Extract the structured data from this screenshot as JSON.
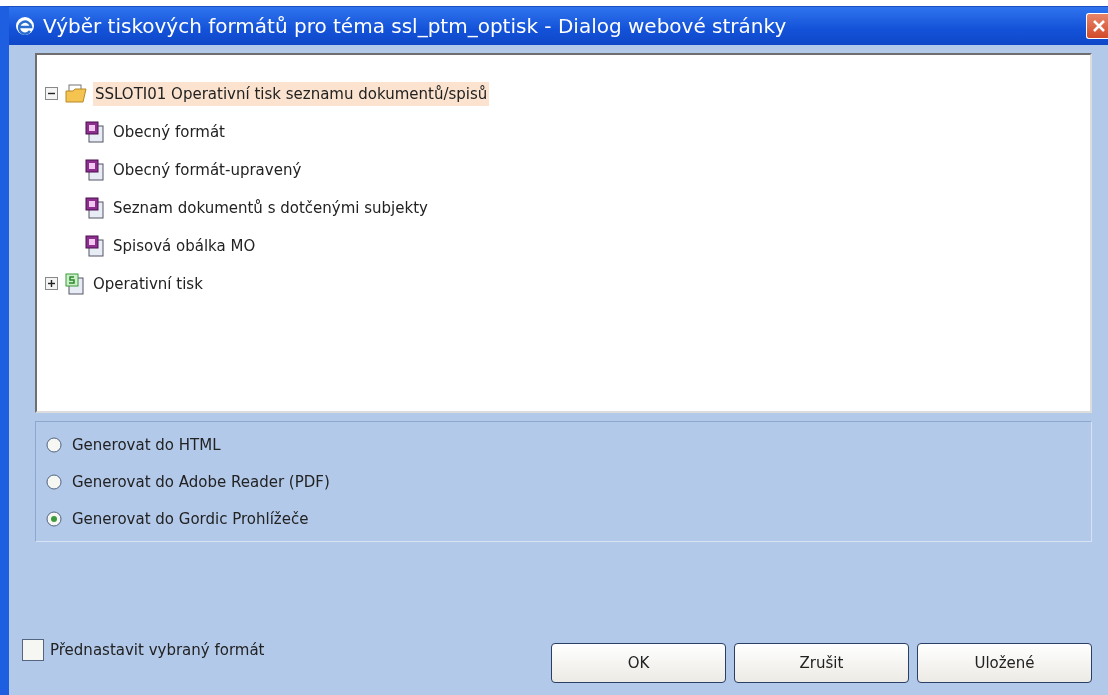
{
  "window": {
    "title": "Výběr tiskových formátů pro téma ssl_ptm_optisk - Dialog webové stránky"
  },
  "tree": [
    {
      "label": "SSLOTI01 Operativní tisk seznamu dokumentů/spisů",
      "kind": "folder",
      "expanded": true,
      "selected": true,
      "children": [
        {
          "label": "Obecný formát",
          "kind": "format",
          "selected": false
        },
        {
          "label": "Obecný formát-upravený",
          "kind": "format",
          "selected": false
        },
        {
          "label": "Seznam dokumentů s dotčenými subjekty",
          "kind": "format",
          "selected": false
        },
        {
          "label": "Spisová obálka MO",
          "kind": "format",
          "selected": false
        }
      ]
    },
    {
      "label": "Operativní tisk",
      "kind": "sheet",
      "expanded": false,
      "selected": false
    }
  ],
  "output_options": [
    {
      "label": "Generovat do HTML",
      "selected": false
    },
    {
      "label": "Generovat do Adobe Reader (PDF)",
      "selected": false
    },
    {
      "label": "Generovat do Gordic Prohlížeče",
      "selected": true
    }
  ],
  "preset": {
    "label": "Přednastavit vybraný formát",
    "checked": false
  },
  "buttons": [
    "OK",
    "Zrušit",
    "Uložené"
  ]
}
